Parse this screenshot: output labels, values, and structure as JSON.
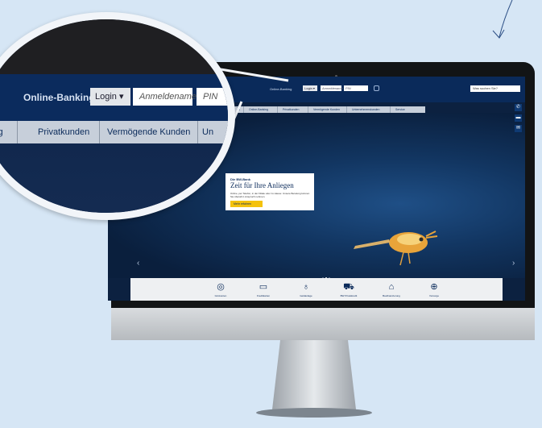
{
  "screen": {
    "topbar": {
      "online_banking_label": "Online-Banking",
      "login_select": "Login ▾",
      "username_placeholder": "Anmeldename",
      "pin_placeholder": "PIN",
      "search_placeholder": "Was suchen Sie?"
    },
    "nav": {
      "items": [
        "Online-Banking",
        "Privatkunden",
        "Vermögende Kunden",
        "Unternehmenskunden",
        "Service"
      ]
    },
    "hero": {
      "kicker": "Die BW-Bank",
      "title": "Zeit für Ihre Anliegen",
      "text": "Online, per Telefon, in der Filiale oder zu Hause: Unsere Beratung können Sie überall in Anspruch nehmen.",
      "button": "Mehr erfahren",
      "slide_count": 3,
      "active_slide": 1
    },
    "quicklinks": [
      {
        "icon": "coins-icon",
        "label": "Girokonten"
      },
      {
        "icon": "card-icon",
        "label": "Kreditkarten"
      },
      {
        "icon": "piggy-bank-icon",
        "label": "Geldanlage"
      },
      {
        "icon": "cart-icon",
        "label": "BW Privatkredit"
      },
      {
        "icon": "house-icon",
        "label": "Baufinanzierung"
      },
      {
        "icon": "lifebuoy-icon",
        "label": "Vorsorge"
      }
    ]
  },
  "magnifier": {
    "online_banking_label": "Online-Banking",
    "login_select": "Login ▾",
    "username_placeholder": "Anmeldename",
    "pin_placeholder": "PIN",
    "nav": [
      "ing",
      "Privatkunden",
      "Vermögende Kunden",
      "Un"
    ]
  },
  "colors": {
    "page_background": "#d6e6f5",
    "brand_navy": "#0a2a5a",
    "accent_yellow": "#f4c20d"
  }
}
